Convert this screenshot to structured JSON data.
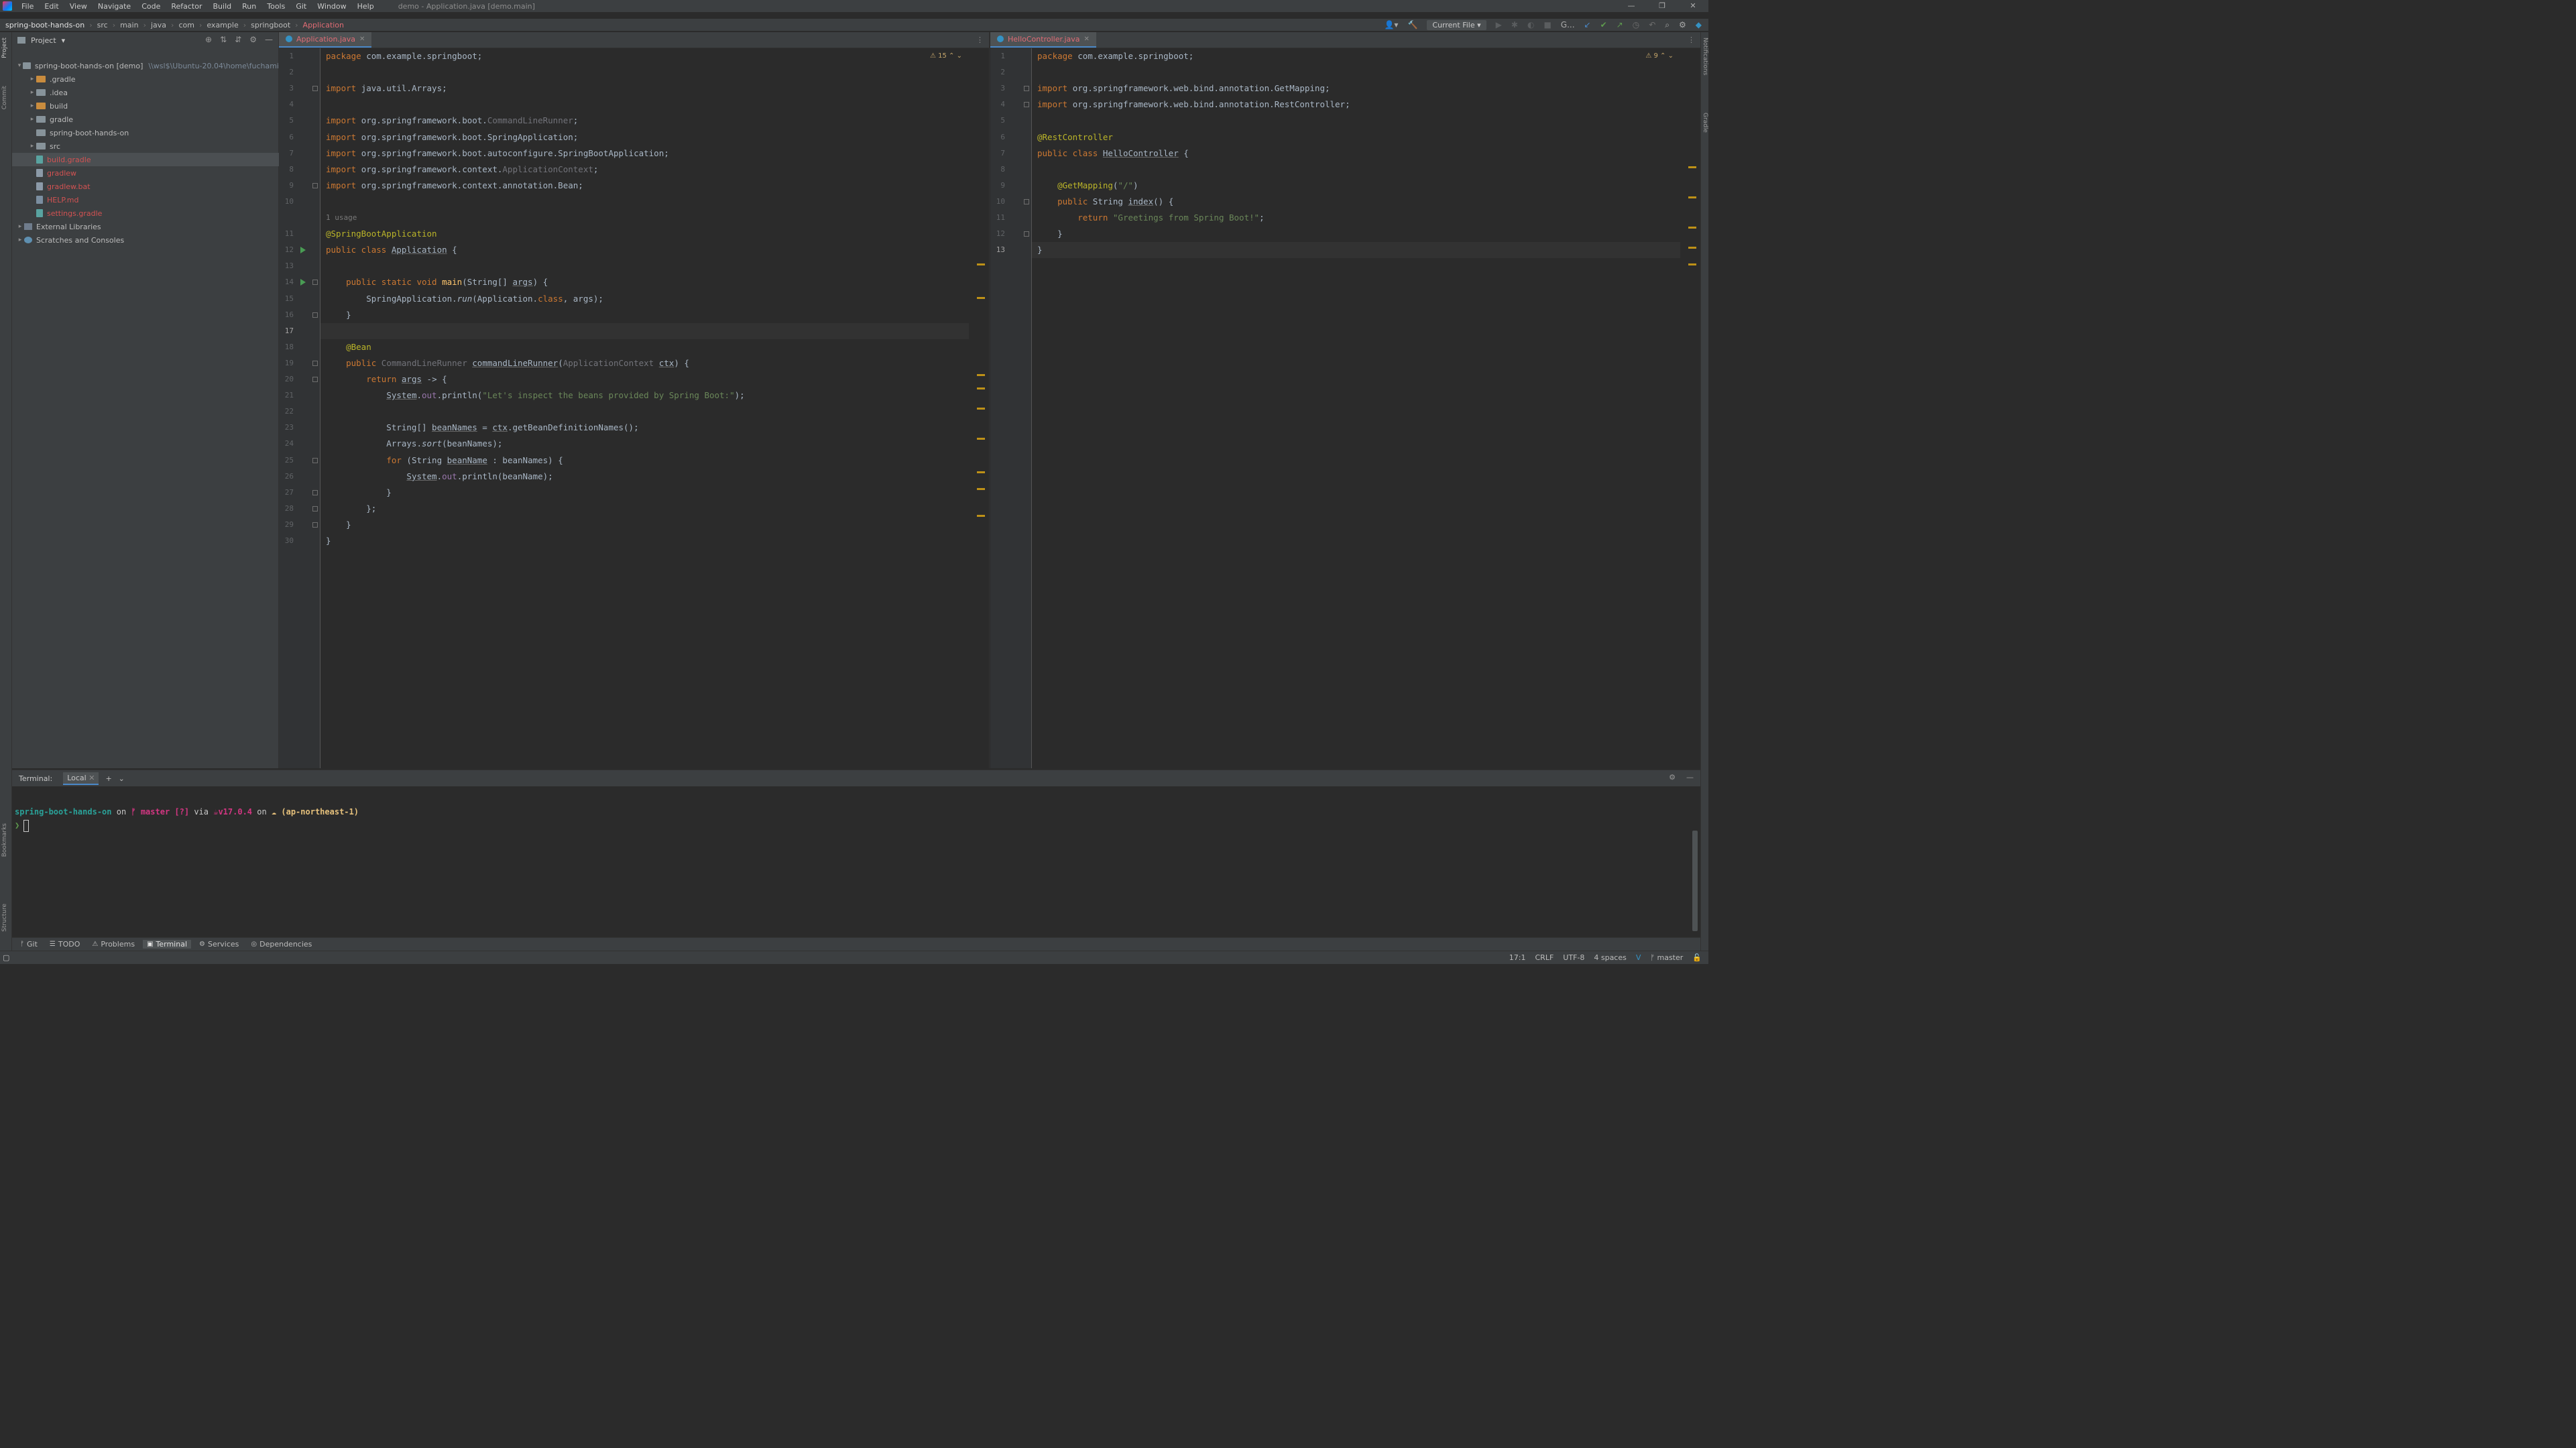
{
  "window": {
    "title": "demo - Application.java [demo.main]",
    "menu": [
      "File",
      "Edit",
      "View",
      "Navigate",
      "Code",
      "Refactor",
      "Build",
      "Run",
      "Tools",
      "Git",
      "Window",
      "Help"
    ]
  },
  "navbar": {
    "breadcrumbs": [
      "spring-boot-hands-on",
      "src",
      "main",
      "java",
      "com",
      "example",
      "springboot",
      "Application"
    ],
    "run_config": "Current File",
    "git_label": "G..."
  },
  "project": {
    "title": "Project",
    "tree": [
      {
        "label": "spring-boot-hands-on [demo]",
        "hint": "\\\\wsl$\\Ubuntu-20.04\\home\\fuchami",
        "type": "module",
        "style": "norm",
        "expanded": true,
        "depth": 0
      },
      {
        "label": ".gradle",
        "type": "folder-orange",
        "style": "norm",
        "expanded": false,
        "depth": 1
      },
      {
        "label": ".idea",
        "type": "folder",
        "style": "norm",
        "expanded": false,
        "depth": 1
      },
      {
        "label": "build",
        "type": "folder-orange",
        "style": "norm",
        "expanded": false,
        "depth": 1
      },
      {
        "label": "gradle",
        "type": "folder",
        "style": "norm",
        "expanded": false,
        "depth": 1
      },
      {
        "label": "spring-boot-hands-on",
        "type": "folder",
        "style": "norm",
        "expanded": null,
        "depth": 1
      },
      {
        "label": "src",
        "type": "folder",
        "style": "norm",
        "expanded": false,
        "depth": 1
      },
      {
        "label": "build.gradle",
        "type": "gradle",
        "style": "red",
        "expanded": null,
        "depth": 1,
        "selected": true
      },
      {
        "label": "gradlew",
        "type": "file",
        "style": "red",
        "expanded": null,
        "depth": 1
      },
      {
        "label": "gradlew.bat",
        "type": "file",
        "style": "red",
        "expanded": null,
        "depth": 1
      },
      {
        "label": "HELP.md",
        "type": "md",
        "style": "red",
        "expanded": null,
        "depth": 1
      },
      {
        "label": "settings.gradle",
        "type": "gradle",
        "style": "red",
        "expanded": null,
        "depth": 1
      },
      {
        "label": "External Libraries",
        "type": "lib",
        "style": "norm",
        "expanded": false,
        "depth": 0
      },
      {
        "label": "Scratches and Consoles",
        "type": "scratch",
        "style": "norm",
        "expanded": false,
        "depth": 0
      }
    ]
  },
  "editor_left": {
    "tab": "Application.java",
    "warnings": "15",
    "lines": [
      [
        [
          "kw",
          "package "
        ],
        [
          "pkg",
          "com.example.springboot"
        ],
        [
          "pl",
          ";"
        ]
      ],
      [],
      [
        [
          "kw",
          "import "
        ],
        [
          "pkg",
          "java.util.Arrays"
        ],
        [
          "pl",
          ";"
        ]
      ],
      [],
      [
        [
          "kw",
          "import "
        ],
        [
          "pkg",
          "org.springframework.boot."
        ],
        [
          "unused",
          "CommandLineRunner"
        ],
        [
          "pl",
          ";"
        ]
      ],
      [
        [
          "kw",
          "import "
        ],
        [
          "pkg",
          "org.springframework.boot.SpringApplication"
        ],
        [
          "pl",
          ";"
        ]
      ],
      [
        [
          "kw",
          "import "
        ],
        [
          "pkg",
          "org.springframework.boot.autoconfigure.SpringBootApplication"
        ],
        [
          "pl",
          ";"
        ]
      ],
      [
        [
          "kw",
          "import "
        ],
        [
          "pkg",
          "org.springframework.context."
        ],
        [
          "unused",
          "ApplicationContext"
        ],
        [
          "pl",
          ";"
        ]
      ],
      [
        [
          "kw",
          "import "
        ],
        [
          "pkg",
          "org.springframework.context.annotation.Bean"
        ],
        [
          "pl",
          ";"
        ]
      ],
      [],
      [
        [
          "ann",
          "@SpringBootApplication"
        ]
      ],
      [
        [
          "kw",
          "public class "
        ],
        [
          "param",
          "Application"
        ],
        [
          "pl",
          " {"
        ]
      ],
      [],
      [
        [
          "pl",
          "    "
        ],
        [
          "kw",
          "public static void "
        ],
        [
          "mth",
          "main"
        ],
        [
          "pl",
          "(String[] "
        ],
        [
          "param",
          "args"
        ],
        [
          "pl",
          ") {"
        ]
      ],
      [
        [
          "pl",
          "        SpringApplication."
        ],
        [
          "fn-st",
          "run"
        ],
        [
          "pl",
          "(Application."
        ],
        [
          "kw",
          "class"
        ],
        [
          "pl",
          ", args);"
        ]
      ],
      [
        [
          "pl",
          "    }"
        ]
      ],
      [],
      [
        [
          "pl",
          "    "
        ],
        [
          "ann",
          "@Bean"
        ]
      ],
      [
        [
          "pl",
          "    "
        ],
        [
          "kw",
          "public "
        ],
        [
          "unused",
          "CommandLineRunner "
        ],
        [
          "param",
          "commandLineRunner"
        ],
        [
          "pl",
          "("
        ],
        [
          "unused",
          "ApplicationContext "
        ],
        [
          "param",
          "ctx"
        ],
        [
          "pl",
          ") {"
        ]
      ],
      [
        [
          "pl",
          "        "
        ],
        [
          "kw",
          "return "
        ],
        [
          "param",
          "args"
        ],
        [
          "pl",
          " -> {"
        ]
      ],
      [
        [
          "pl",
          "            "
        ],
        [
          "param",
          "System"
        ],
        [
          "pl",
          "."
        ],
        [
          "fld",
          "out"
        ],
        [
          "pl",
          ".println("
        ],
        [
          "str",
          "\"Let's inspect the beans provided by Spring Boot:\""
        ],
        [
          "pl",
          ");"
        ]
      ],
      [],
      [
        [
          "pl",
          "            String[] "
        ],
        [
          "param",
          "beanNames"
        ],
        [
          "pl",
          " = "
        ],
        [
          "param",
          "ctx"
        ],
        [
          "pl",
          ".getBeanDefinitionNames();"
        ]
      ],
      [
        [
          "pl",
          "            Arrays."
        ],
        [
          "fn-st",
          "sort"
        ],
        [
          "pl",
          "(beanNames);"
        ]
      ],
      [
        [
          "pl",
          "            "
        ],
        [
          "kw",
          "for "
        ],
        [
          "pl",
          "(String "
        ],
        [
          "param",
          "beanName"
        ],
        [
          "pl",
          " : beanNames) {"
        ]
      ],
      [
        [
          "pl",
          "                "
        ],
        [
          "param",
          "System"
        ],
        [
          "pl",
          "."
        ],
        [
          "fld",
          "out"
        ],
        [
          "pl",
          ".println(beanName);"
        ]
      ],
      [
        [
          "pl",
          "            }"
        ]
      ],
      [
        [
          "pl",
          "        };"
        ]
      ],
      [
        [
          "pl",
          "    }"
        ]
      ],
      [
        [
          "pl",
          "}"
        ]
      ]
    ],
    "usage_hint": "1 usage"
  },
  "editor_right": {
    "tab": "HelloController.java",
    "warnings": "9",
    "lines": [
      [
        [
          "kw",
          "package "
        ],
        [
          "pkg",
          "com.example.springboot"
        ],
        [
          "pl",
          ";"
        ]
      ],
      [],
      [
        [
          "kw",
          "import "
        ],
        [
          "pkg",
          "org.springframework.web.bind.annotation.GetMapping"
        ],
        [
          "pl",
          ";"
        ]
      ],
      [
        [
          "kw",
          "import "
        ],
        [
          "pkg",
          "org.springframework.web.bind.annotation.RestController"
        ],
        [
          "pl",
          ";"
        ]
      ],
      [],
      [
        [
          "ann",
          "@RestController"
        ]
      ],
      [
        [
          "kw",
          "public class "
        ],
        [
          "param",
          "HelloController"
        ],
        [
          "pl",
          " {"
        ]
      ],
      [],
      [
        [
          "pl",
          "    "
        ],
        [
          "ann",
          "@GetMapping"
        ],
        [
          "pl",
          "("
        ],
        [
          "str",
          "\"/\""
        ],
        [
          "pl",
          ")"
        ]
      ],
      [
        [
          "pl",
          "    "
        ],
        [
          "kw",
          "public "
        ],
        [
          "pl",
          "String "
        ],
        [
          "param",
          "index"
        ],
        [
          "pl",
          "() {"
        ]
      ],
      [
        [
          "pl",
          "        "
        ],
        [
          "kw",
          "return "
        ],
        [
          "str",
          "\"Greetings from Spring Boot!\""
        ],
        [
          "pl",
          ";"
        ]
      ],
      [
        [
          "pl",
          "    }"
        ]
      ],
      [
        [
          "pl",
          "}"
        ]
      ]
    ]
  },
  "terminal": {
    "title": "Terminal:",
    "tab": "Local",
    "prompt": {
      "dir": "spring-boot-hands-on",
      "on": " on ",
      "branch_icon": "ᚠ",
      "branch": " master [?]",
      "via": " via ",
      "java": "☕v17.0.4",
      "on2": " on ",
      "cloud_icon": "☁",
      "region": "  (ap-northeast-1)"
    },
    "input_prefix": "❯"
  },
  "bottom_tabs": [
    "Git",
    "TODO",
    "Problems",
    "Terminal",
    "Services",
    "Dependencies"
  ],
  "status": {
    "position": "17:1",
    "line_sep": "CRLF",
    "encoding": "UTF-8",
    "indent": "4 spaces",
    "branch": "master"
  },
  "left_stripe": [
    "Project",
    "Commit",
    "Bookmarks",
    "Structure"
  ],
  "right_stripe": [
    "Notifications",
    "Gradle"
  ]
}
